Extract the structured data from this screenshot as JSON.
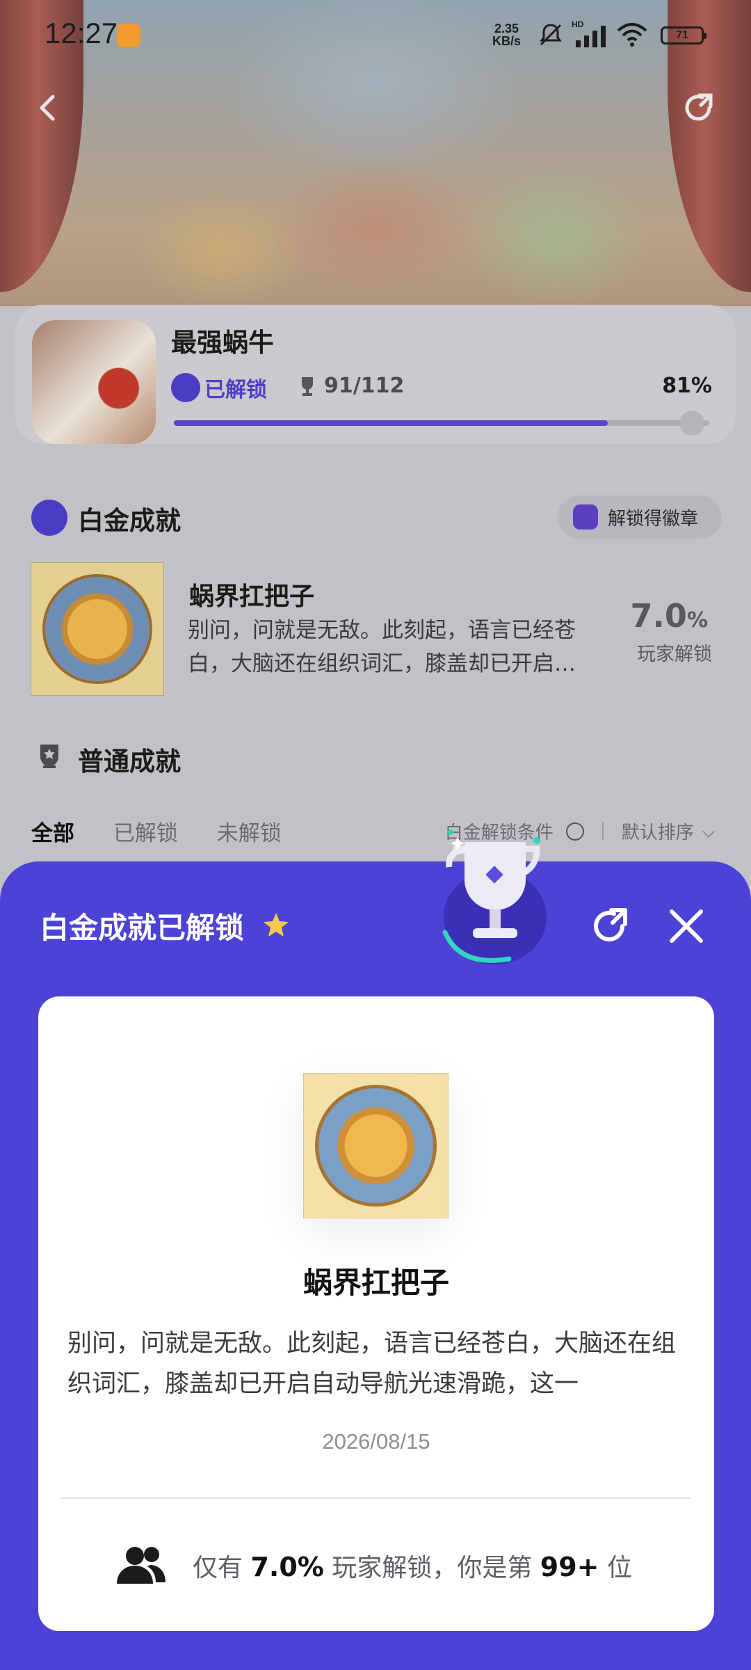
{
  "status_bar": {
    "time": "12:27",
    "net_speed_value": "2.35",
    "net_speed_unit": "KB/s",
    "hd_label": "HD",
    "battery": "71"
  },
  "game": {
    "name": "最强蜗牛",
    "unlock_label": "已解锁",
    "progress_count": "91/112",
    "progress_percent_label": "81%",
    "progress_value": 0.81
  },
  "platinum_section": {
    "title": "白金成就",
    "badge_button": "解锁得徽章",
    "achievement": {
      "name": "蜗界扛把子",
      "description": "别问，问就是无敌。此刻起，语言已经苍白，大脑还在组织词汇，膝盖却已开启…",
      "percent_value": "7.0",
      "percent_unit": "%",
      "percent_label": "玩家解锁"
    }
  },
  "normal_section": {
    "title": "普通成就",
    "tabs": [
      "全部",
      "已解锁",
      "未解锁"
    ],
    "filter_label": "白金解锁条件",
    "sort_label": "默认排序"
  },
  "modal": {
    "title": "白金成就已解锁",
    "achievement_name": "蜗界扛把子",
    "description": "别问，问就是无敌。此刻起，语言已经苍白，大脑还在组织词汇，膝盖却已开启自动导航光速滑跪，这一",
    "date": "2026/08/15",
    "stat_prefix": "仅有",
    "stat_percent": "7.0%",
    "stat_middle": "玩家解锁，你是第",
    "stat_rank": "99+",
    "stat_suffix": "位"
  },
  "colors": {
    "accent": "#4c42d6",
    "progress": "#5344c8"
  }
}
